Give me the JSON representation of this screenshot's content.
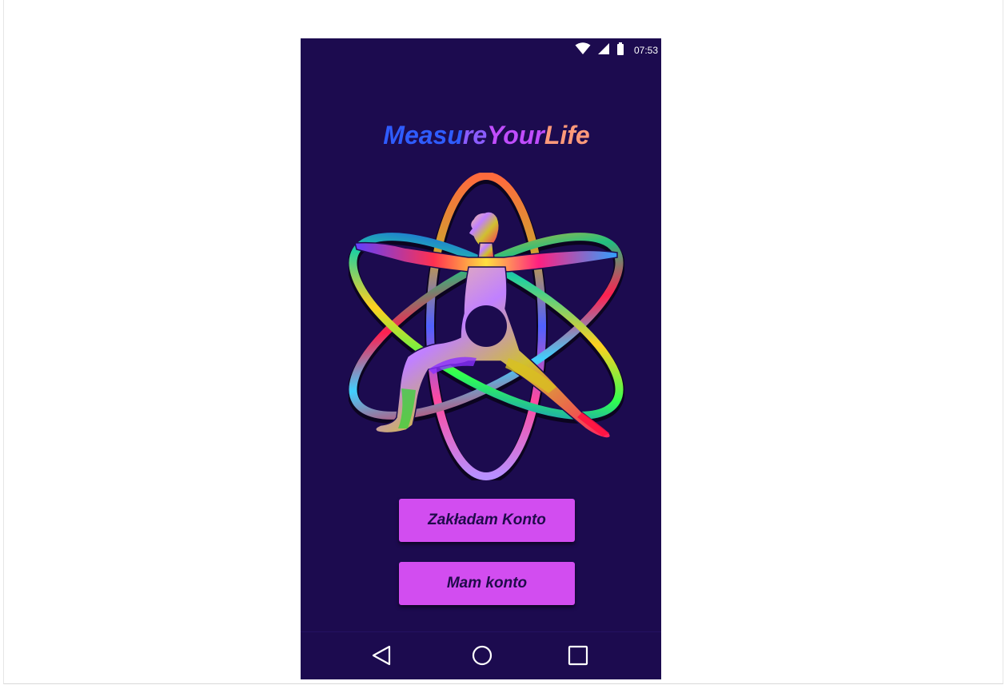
{
  "status_bar": {
    "time": "07:53",
    "icons": [
      "wifi-icon",
      "cell-signal-icon",
      "battery-icon"
    ],
    "color": "#ffffff"
  },
  "app": {
    "title_parts": [
      {
        "text": "Measu",
        "color": "#2f5cff"
      },
      {
        "text": "re",
        "color": "#8a5cff"
      },
      {
        "text": "Your",
        "color": "#c04dff"
      },
      {
        "text": "Life",
        "color": "#ff9a7a"
      }
    ],
    "background": "#1c0b4f",
    "logo": "yoga-atom-logo"
  },
  "buttons": {
    "register_label": "Zakładam Konto",
    "login_label": "Mam konto",
    "color": "#d24df0"
  },
  "navigation": {
    "back": "back-triangle-icon",
    "home": "home-circle-icon",
    "recents": "recents-square-icon"
  }
}
